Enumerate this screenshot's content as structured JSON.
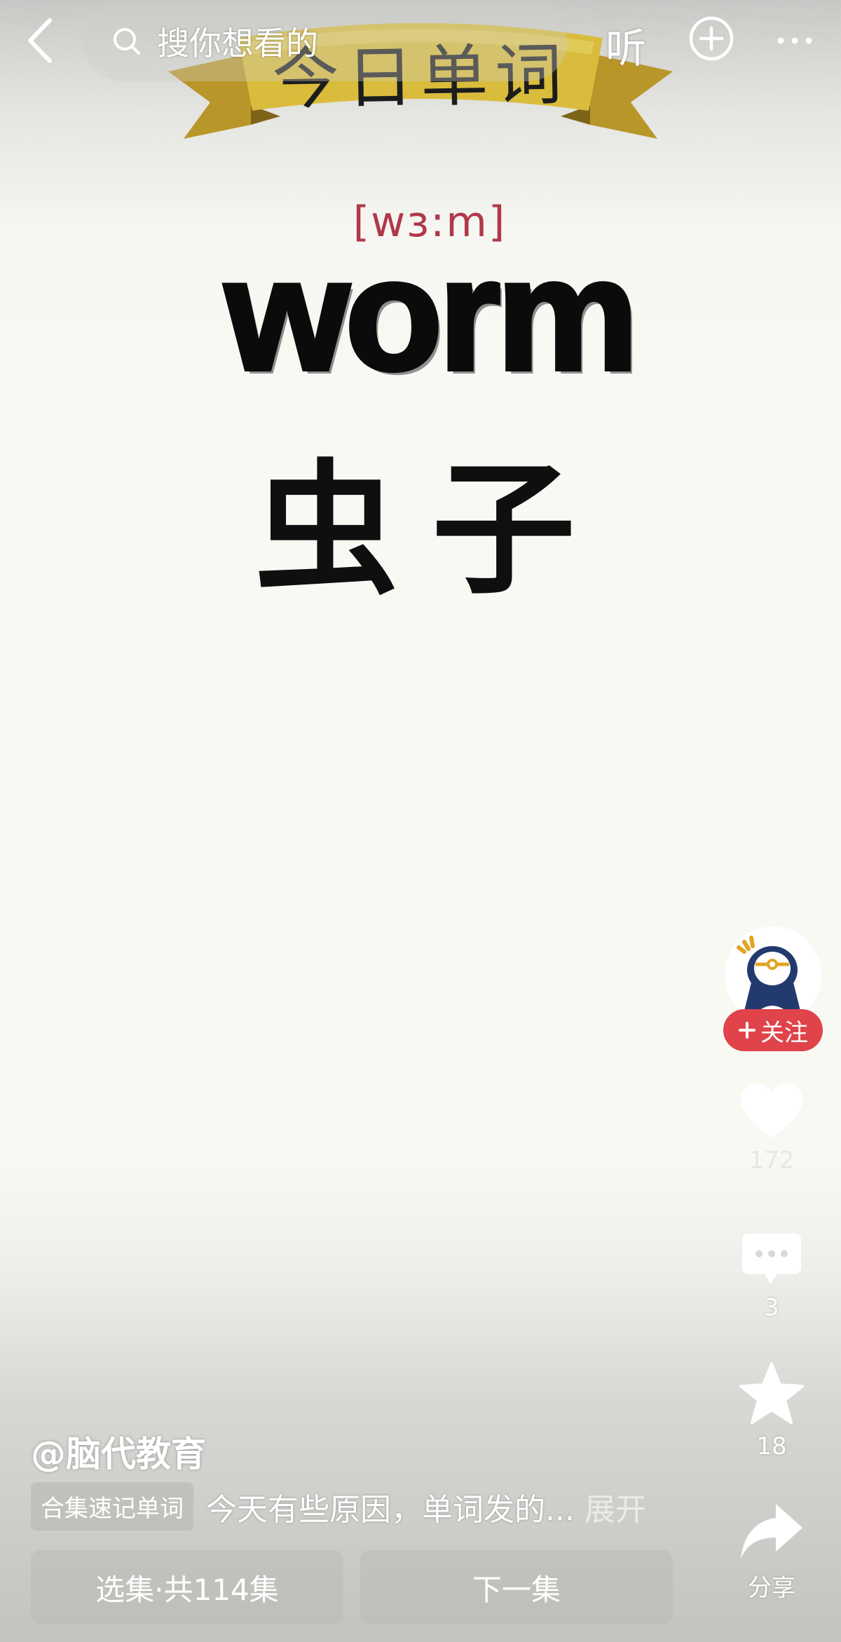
{
  "topbar": {
    "search_placeholder": "搜你想看的",
    "listen_label": "听"
  },
  "video": {
    "banner_title": "今日单词",
    "phonetic": "[wɜ:m]",
    "word": "worm",
    "meaning": "虫子"
  },
  "rail": {
    "follow_label": "关注",
    "likes": "172",
    "comments": "3",
    "favorites": "18",
    "share_label": "分享"
  },
  "info": {
    "author": "@脑代教育",
    "tag": "合集速记单词",
    "caption": "今天有些原因，单词发的...",
    "expand": "展开"
  },
  "bottom": {
    "select_label": "选集·共114集",
    "next_label": "下一集"
  },
  "colors": {
    "follow": "#e0434a",
    "phonetic": "#b0384a",
    "banner_gold": "#d9bc3c"
  }
}
